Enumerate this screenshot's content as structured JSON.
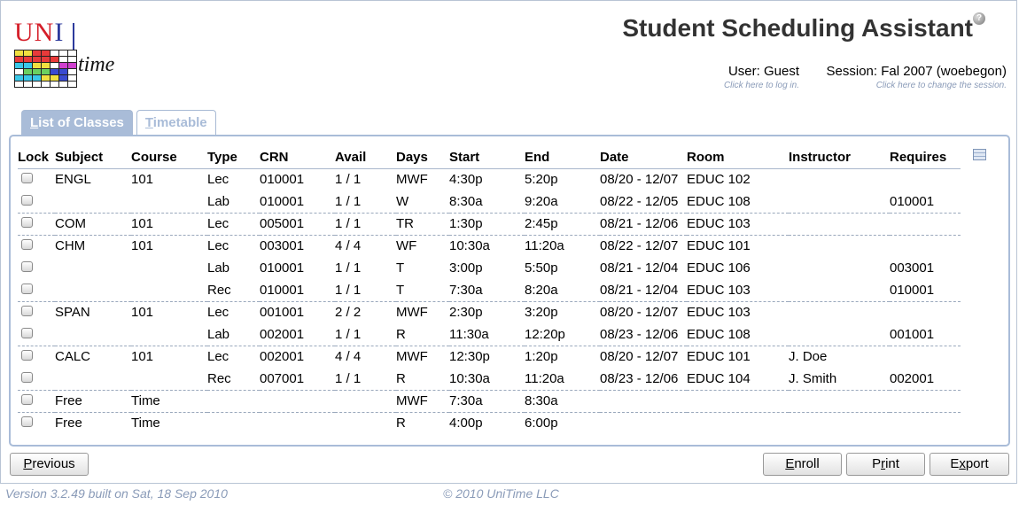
{
  "logo": {
    "part1": "UN",
    "part2": "I",
    "sub": "time"
  },
  "app_title": "Student Scheduling Assistant",
  "help_icon": "question-circle-icon",
  "user": {
    "label": "User: Guest",
    "hint": "Click here to log in."
  },
  "session": {
    "label": "Session: Fal 2007 (woebegon)",
    "hint": "Click here to change the session."
  },
  "tabs": [
    {
      "label_first": "L",
      "label_rest": "ist of Classes",
      "active": true
    },
    {
      "label_first": "T",
      "label_rest": "imetable",
      "active": false
    }
  ],
  "table": {
    "headers": [
      "Lock",
      "Subject",
      "Course",
      "Type",
      "CRN",
      "Avail",
      "Days",
      "Start",
      "End",
      "Date",
      "Room",
      "Instructor",
      "Requires"
    ],
    "rows": [
      {
        "sep": false,
        "cells": [
          "ENGL",
          "101",
          "Lec",
          "010001",
          "1 / 1",
          "MWF",
          "4:30p",
          "5:20p",
          "08/20 - 12/07",
          "EDUC 102",
          "",
          ""
        ]
      },
      {
        "sep": false,
        "cells": [
          "",
          "",
          "Lab",
          "010001",
          "1 / 1",
          "W",
          "8:30a",
          "9:20a",
          "08/22 - 12/05",
          "EDUC 108",
          "",
          "010001"
        ]
      },
      {
        "sep": true,
        "cells": [
          "COM",
          "101",
          "Lec",
          "005001",
          "1 / 1",
          "TR",
          "1:30p",
          "2:45p",
          "08/21 - 12/06",
          "EDUC 103",
          "",
          ""
        ]
      },
      {
        "sep": true,
        "cells": [
          "CHM",
          "101",
          "Lec",
          "003001",
          "4 / 4",
          "WF",
          "10:30a",
          "11:20a",
          "08/22 - 12/07",
          "EDUC 101",
          "",
          ""
        ]
      },
      {
        "sep": false,
        "cells": [
          "",
          "",
          "Lab",
          "010001",
          "1 / 1",
          "T",
          "3:00p",
          "5:50p",
          "08/21 - 12/04",
          "EDUC 106",
          "",
          "003001"
        ]
      },
      {
        "sep": false,
        "cells": [
          "",
          "",
          "Rec",
          "010001",
          "1 / 1",
          "T",
          "7:30a",
          "8:20a",
          "08/21 - 12/04",
          "EDUC 103",
          "",
          "010001"
        ]
      },
      {
        "sep": true,
        "cells": [
          "SPAN",
          "101",
          "Lec",
          "001001",
          "2 / 2",
          "MWF",
          "2:30p",
          "3:20p",
          "08/20 - 12/07",
          "EDUC 103",
          "",
          ""
        ]
      },
      {
        "sep": false,
        "cells": [
          "",
          "",
          "Lab",
          "002001",
          "1 / 1",
          "R",
          "11:30a",
          "12:20p",
          "08/23 - 12/06",
          "EDUC 108",
          "",
          "001001"
        ]
      },
      {
        "sep": true,
        "cells": [
          "CALC",
          "101",
          "Lec",
          "002001",
          "4 / 4",
          "MWF",
          "12:30p",
          "1:20p",
          "08/20 - 12/07",
          "EDUC 101",
          "J. Doe",
          ""
        ]
      },
      {
        "sep": false,
        "cells": [
          "",
          "",
          "Rec",
          "007001",
          "1 / 1",
          "R",
          "10:30a",
          "11:20a",
          "08/23 - 12/06",
          "EDUC 104",
          "J. Smith",
          "002001"
        ]
      },
      {
        "sep": true,
        "cells": [
          "Free",
          "Time",
          "",
          "",
          "",
          "MWF",
          "7:30a",
          "8:30a",
          "",
          "",
          "",
          ""
        ]
      },
      {
        "sep": true,
        "cells": [
          "Free",
          "Time",
          "",
          "",
          "",
          "R",
          "4:00p",
          "6:00p",
          "",
          "",
          "",
          ""
        ]
      }
    ]
  },
  "buttons": {
    "previous": {
      "first": "P",
      "rest": "revious"
    },
    "enroll": {
      "first": "E",
      "rest": "nroll"
    },
    "print": {
      "pre": "P",
      "mid": "r",
      "post": "int"
    },
    "export": {
      "pre": "E",
      "mid": "x",
      "post": "port"
    }
  },
  "footer": {
    "version": "Version 3.2.49 built on Sat, 18 Sep 2010",
    "copyright": "© 2010 UniTime LLC"
  }
}
